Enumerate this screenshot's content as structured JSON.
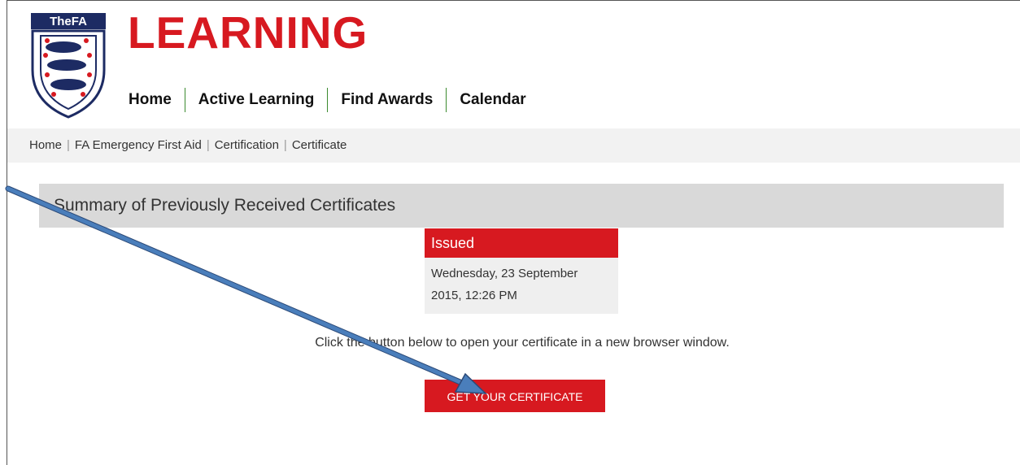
{
  "logo": {
    "label": "TheFA"
  },
  "brand": {
    "title": "LEARNING"
  },
  "nav": {
    "items": [
      {
        "label": "Home"
      },
      {
        "label": "Active Learning"
      },
      {
        "label": "Find Awards"
      },
      {
        "label": "Calendar"
      }
    ]
  },
  "breadcrumb": {
    "items": [
      {
        "label": "Home"
      },
      {
        "label": "FA Emergency First Aid"
      },
      {
        "label": "Certification"
      },
      {
        "label": "Certificate"
      }
    ],
    "separator": "|"
  },
  "summary": {
    "title": "Summary of Previously Received Certificates"
  },
  "issued": {
    "label": "Issued",
    "line1": "Wednesday, 23 September",
    "line2": "2015, 12:26 PM"
  },
  "instruction": "Click the button below to open your certificate in a new browser window.",
  "certificate_button": {
    "label": "GET YOUR CERTIFICATE"
  },
  "colors": {
    "brand_red": "#d71920",
    "nav_divider": "#3b8a2f",
    "arrow_blue": "#4a7ebb"
  }
}
